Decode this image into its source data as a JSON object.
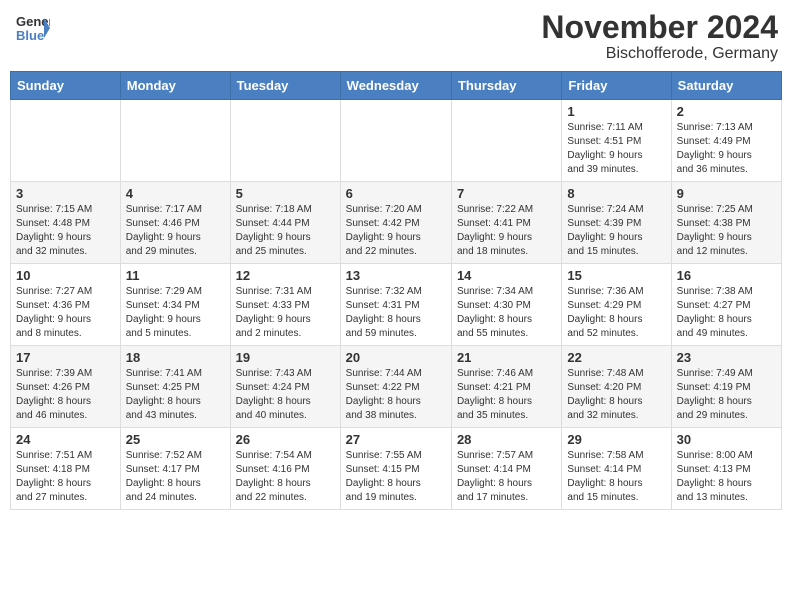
{
  "header": {
    "logo_general": "General",
    "logo_blue": "Blue",
    "month_title": "November 2024",
    "location": "Bischofferode, Germany"
  },
  "weekdays": [
    "Sunday",
    "Monday",
    "Tuesday",
    "Wednesday",
    "Thursday",
    "Friday",
    "Saturday"
  ],
  "weeks": [
    [
      {
        "day": "",
        "info": ""
      },
      {
        "day": "",
        "info": ""
      },
      {
        "day": "",
        "info": ""
      },
      {
        "day": "",
        "info": ""
      },
      {
        "day": "",
        "info": ""
      },
      {
        "day": "1",
        "info": "Sunrise: 7:11 AM\nSunset: 4:51 PM\nDaylight: 9 hours\nand 39 minutes."
      },
      {
        "day": "2",
        "info": "Sunrise: 7:13 AM\nSunset: 4:49 PM\nDaylight: 9 hours\nand 36 minutes."
      }
    ],
    [
      {
        "day": "3",
        "info": "Sunrise: 7:15 AM\nSunset: 4:48 PM\nDaylight: 9 hours\nand 32 minutes."
      },
      {
        "day": "4",
        "info": "Sunrise: 7:17 AM\nSunset: 4:46 PM\nDaylight: 9 hours\nand 29 minutes."
      },
      {
        "day": "5",
        "info": "Sunrise: 7:18 AM\nSunset: 4:44 PM\nDaylight: 9 hours\nand 25 minutes."
      },
      {
        "day": "6",
        "info": "Sunrise: 7:20 AM\nSunset: 4:42 PM\nDaylight: 9 hours\nand 22 minutes."
      },
      {
        "day": "7",
        "info": "Sunrise: 7:22 AM\nSunset: 4:41 PM\nDaylight: 9 hours\nand 18 minutes."
      },
      {
        "day": "8",
        "info": "Sunrise: 7:24 AM\nSunset: 4:39 PM\nDaylight: 9 hours\nand 15 minutes."
      },
      {
        "day": "9",
        "info": "Sunrise: 7:25 AM\nSunset: 4:38 PM\nDaylight: 9 hours\nand 12 minutes."
      }
    ],
    [
      {
        "day": "10",
        "info": "Sunrise: 7:27 AM\nSunset: 4:36 PM\nDaylight: 9 hours\nand 8 minutes."
      },
      {
        "day": "11",
        "info": "Sunrise: 7:29 AM\nSunset: 4:34 PM\nDaylight: 9 hours\nand 5 minutes."
      },
      {
        "day": "12",
        "info": "Sunrise: 7:31 AM\nSunset: 4:33 PM\nDaylight: 9 hours\nand 2 minutes."
      },
      {
        "day": "13",
        "info": "Sunrise: 7:32 AM\nSunset: 4:31 PM\nDaylight: 8 hours\nand 59 minutes."
      },
      {
        "day": "14",
        "info": "Sunrise: 7:34 AM\nSunset: 4:30 PM\nDaylight: 8 hours\nand 55 minutes."
      },
      {
        "day": "15",
        "info": "Sunrise: 7:36 AM\nSunset: 4:29 PM\nDaylight: 8 hours\nand 52 minutes."
      },
      {
        "day": "16",
        "info": "Sunrise: 7:38 AM\nSunset: 4:27 PM\nDaylight: 8 hours\nand 49 minutes."
      }
    ],
    [
      {
        "day": "17",
        "info": "Sunrise: 7:39 AM\nSunset: 4:26 PM\nDaylight: 8 hours\nand 46 minutes."
      },
      {
        "day": "18",
        "info": "Sunrise: 7:41 AM\nSunset: 4:25 PM\nDaylight: 8 hours\nand 43 minutes."
      },
      {
        "day": "19",
        "info": "Sunrise: 7:43 AM\nSunset: 4:24 PM\nDaylight: 8 hours\nand 40 minutes."
      },
      {
        "day": "20",
        "info": "Sunrise: 7:44 AM\nSunset: 4:22 PM\nDaylight: 8 hours\nand 38 minutes."
      },
      {
        "day": "21",
        "info": "Sunrise: 7:46 AM\nSunset: 4:21 PM\nDaylight: 8 hours\nand 35 minutes."
      },
      {
        "day": "22",
        "info": "Sunrise: 7:48 AM\nSunset: 4:20 PM\nDaylight: 8 hours\nand 32 minutes."
      },
      {
        "day": "23",
        "info": "Sunrise: 7:49 AM\nSunset: 4:19 PM\nDaylight: 8 hours\nand 29 minutes."
      }
    ],
    [
      {
        "day": "24",
        "info": "Sunrise: 7:51 AM\nSunset: 4:18 PM\nDaylight: 8 hours\nand 27 minutes."
      },
      {
        "day": "25",
        "info": "Sunrise: 7:52 AM\nSunset: 4:17 PM\nDaylight: 8 hours\nand 24 minutes."
      },
      {
        "day": "26",
        "info": "Sunrise: 7:54 AM\nSunset: 4:16 PM\nDaylight: 8 hours\nand 22 minutes."
      },
      {
        "day": "27",
        "info": "Sunrise: 7:55 AM\nSunset: 4:15 PM\nDaylight: 8 hours\nand 19 minutes."
      },
      {
        "day": "28",
        "info": "Sunrise: 7:57 AM\nSunset: 4:14 PM\nDaylight: 8 hours\nand 17 minutes."
      },
      {
        "day": "29",
        "info": "Sunrise: 7:58 AM\nSunset: 4:14 PM\nDaylight: 8 hours\nand 15 minutes."
      },
      {
        "day": "30",
        "info": "Sunrise: 8:00 AM\nSunset: 4:13 PM\nDaylight: 8 hours\nand 13 minutes."
      }
    ]
  ]
}
